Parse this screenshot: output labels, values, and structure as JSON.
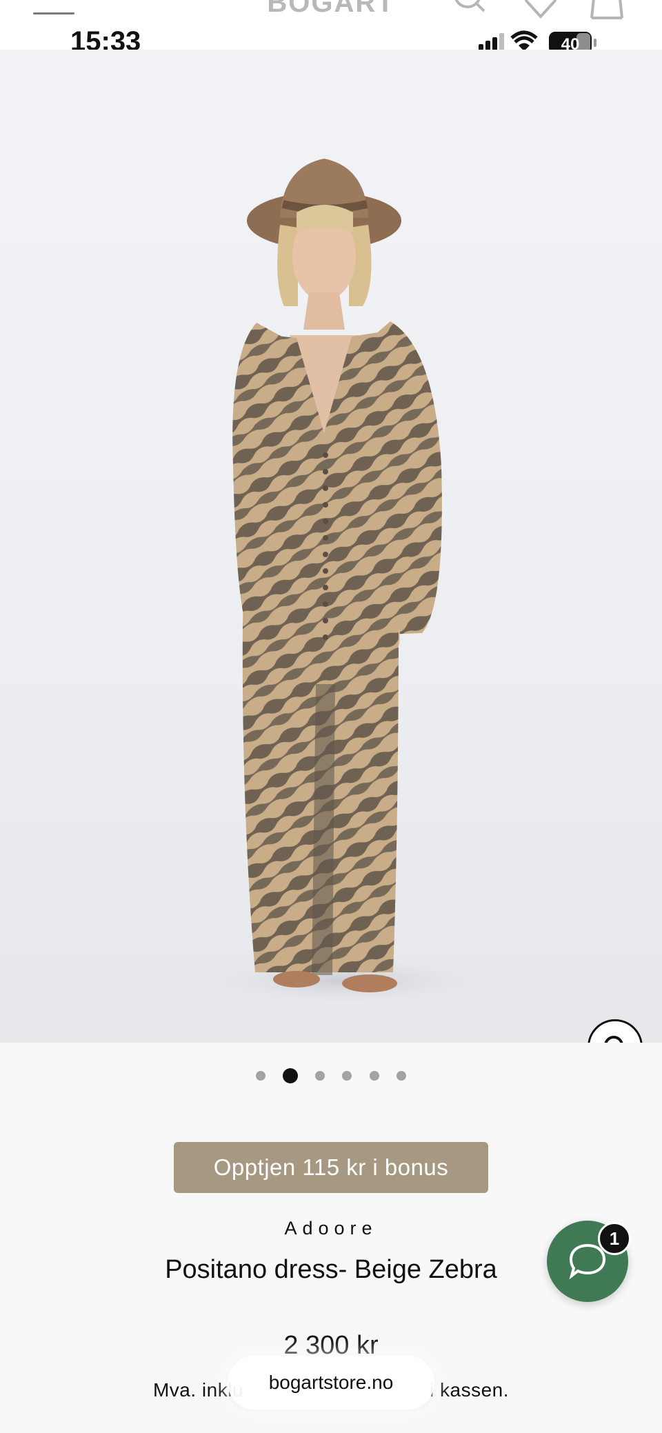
{
  "status_bar": {
    "time": "15:33",
    "battery": "40",
    "icons": [
      "signal-icon",
      "wifi-icon",
      "battery-icon"
    ]
  },
  "header": {
    "logo": "BOGART",
    "icons": [
      "menu-icon",
      "search-icon",
      "heart-icon",
      "bag-icon"
    ]
  },
  "product": {
    "image_icon": "zoom-icon",
    "carousel": {
      "total": 6,
      "active_index": 1
    },
    "bonus_label": "Opptjen 115 kr i bonus",
    "brand": "Adoore",
    "title": "Positano dress- Beige Zebra",
    "price": "2 300 kr",
    "vat_note_start": "Mva. inklu",
    "vat_note_end": "i kassen."
  },
  "browser": {
    "url": "bogartstore.no"
  },
  "chat": {
    "icon": "chat-icon",
    "badge_count": "1"
  },
  "colors": {
    "bonus_background": "#a79882",
    "chat_background": "#3f7a55",
    "dress_base": "#c8ad88",
    "dress_stripe": "#6f6252"
  }
}
